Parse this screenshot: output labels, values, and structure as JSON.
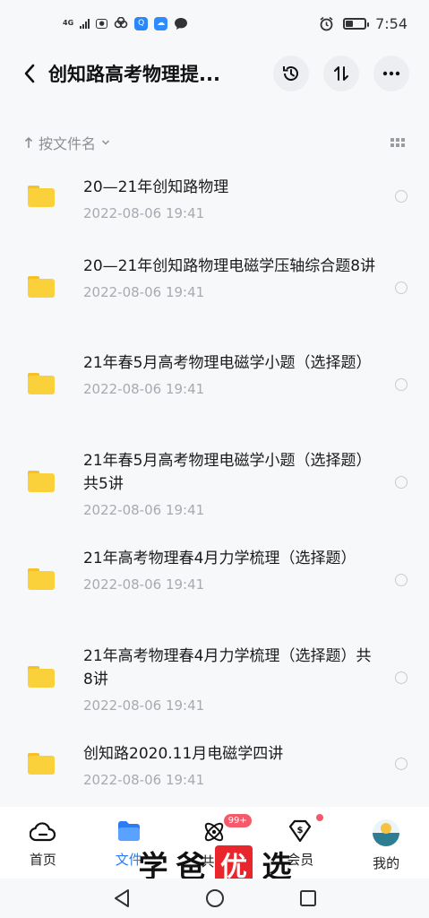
{
  "status_bar": {
    "network": "4G",
    "time": "7:54",
    "colors": {
      "qq": "#2b86f7",
      "cloud": "#2f8cff"
    }
  },
  "header": {
    "title": "创知路高考物理提...",
    "icons": [
      "back-icon",
      "history-icon",
      "sort-icon",
      "more-icon"
    ]
  },
  "sort_bar": {
    "label": "按文件名"
  },
  "files": [
    {
      "name": "20—21年创知路物理",
      "date": "2022-08-06  19:41"
    },
    {
      "name": "20—21年创知路物理电磁学压轴综合题8讲",
      "date": "2022-08-06  19:41"
    },
    {
      "name": "21年春5月高考物理电磁学小题（选择题）",
      "date": "2022-08-06  19:41"
    },
    {
      "name": "21年春5月高考物理电磁学小题（选择题）共5讲",
      "date": "2022-08-06  19:41"
    },
    {
      "name": "21年高考物理春4月力学梳理（选择题）",
      "date": "2022-08-06  19:41"
    },
    {
      "name": "21年高考物理春4月力学梳理（选择题）共8讲",
      "date": "2022-08-06  19:41"
    },
    {
      "name": "创知路2020.11月电磁学四讲",
      "date": "2022-08-06  19:41"
    }
  ],
  "bottom_nav": {
    "items": [
      {
        "label": "首页",
        "icon": "home-icon"
      },
      {
        "label": "文件",
        "icon": "file-icon",
        "active": true
      },
      {
        "label": "共享",
        "icon": "share-icon",
        "badge": "99+"
      },
      {
        "label": "会员",
        "icon": "vip-icon",
        "dot": true
      },
      {
        "label": "我的",
        "icon": "avatar"
      }
    ],
    "active_color": "#2b7bf6",
    "badge_color": "#f45a6a"
  },
  "watermark": {
    "chars": [
      "学",
      "爸",
      "优",
      "选"
    ]
  }
}
